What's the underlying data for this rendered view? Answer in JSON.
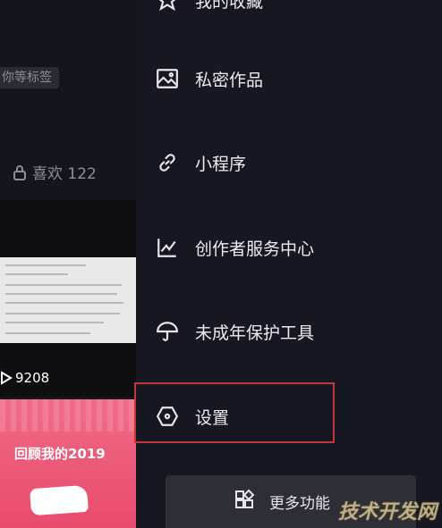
{
  "left_panel": {
    "tag_text": "你等标签",
    "likes_label": "喜欢 122",
    "video1_views": "9208",
    "video2_caption": "回顾我的2019"
  },
  "drawer": {
    "items": [
      {
        "label": "我的收藏",
        "icon": "star-icon"
      },
      {
        "label": "私密作品",
        "icon": "image-icon"
      },
      {
        "label": "小程序",
        "icon": "link-icon"
      },
      {
        "label": "创作者服务中心",
        "icon": "chart-icon"
      },
      {
        "label": "未成年保护工具",
        "icon": "umbrella-icon"
      },
      {
        "label": "设置",
        "icon": "hexagon-icon"
      }
    ],
    "more_label": "更多功能"
  },
  "watermark": "技术开发网",
  "colors": {
    "highlight": "#c8343c",
    "background": "#161720"
  }
}
